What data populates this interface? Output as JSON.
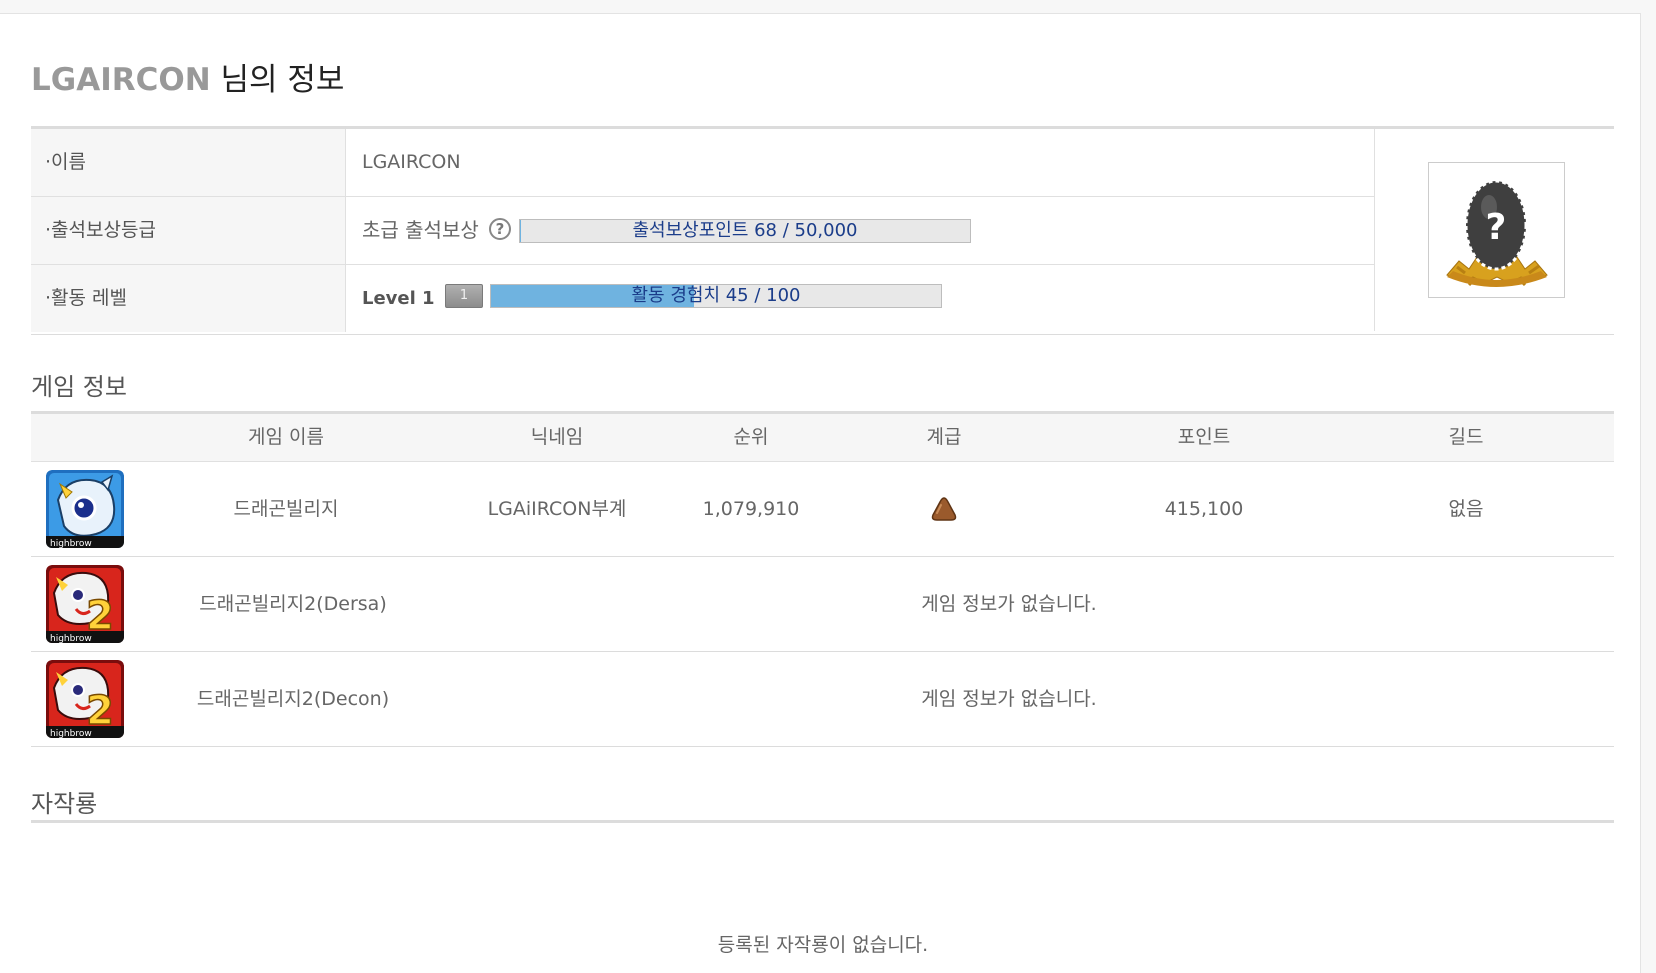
{
  "page_title": {
    "username": "LGAIRCON",
    "suffix": "님의 정보"
  },
  "profile": {
    "name_label": "·이름",
    "name_value": "LGAIRCON",
    "attendance_label": "·출석보상등급",
    "attendance_grade": "초급 출석보상",
    "attendance_help": "?",
    "attendance_bar_text": "출석보상포인트 68 / 50,000",
    "attendance_progress": 0.0014,
    "activity_label": "·활동 레벨",
    "level_text": "Level 1",
    "level_badge": "1",
    "exp_bar_text": "활동 경험치 45 / 100",
    "exp_progress": 0.45,
    "avatar_icon": "mystery-egg-icon"
  },
  "game_section": {
    "title": "게임 정보",
    "headers": [
      "게임 이름",
      "닉네임",
      "순위",
      "계급",
      "포인트",
      "길드"
    ],
    "rows": [
      {
        "game": "드래곤빌리지",
        "nickname": "LGAiIRCON부계",
        "rank": "1,079,910",
        "grade_icon": "brown-rank-icon",
        "points": "415,100",
        "guild": "없음",
        "icon": "dragon-village-icon"
      },
      {
        "game": "드래곤빌리지2(Dersa)",
        "message": "게임 정보가 없습니다.",
        "icon": "dragon-village-2-icon"
      },
      {
        "game": "드래곤빌리지2(Decon)",
        "message": "게임 정보가 없습니다.",
        "icon": "dragon-village-2-icon"
      }
    ]
  },
  "dragon_section": {
    "title": "자작룡",
    "empty_message": "등록된 자작룡이 없습니다."
  }
}
